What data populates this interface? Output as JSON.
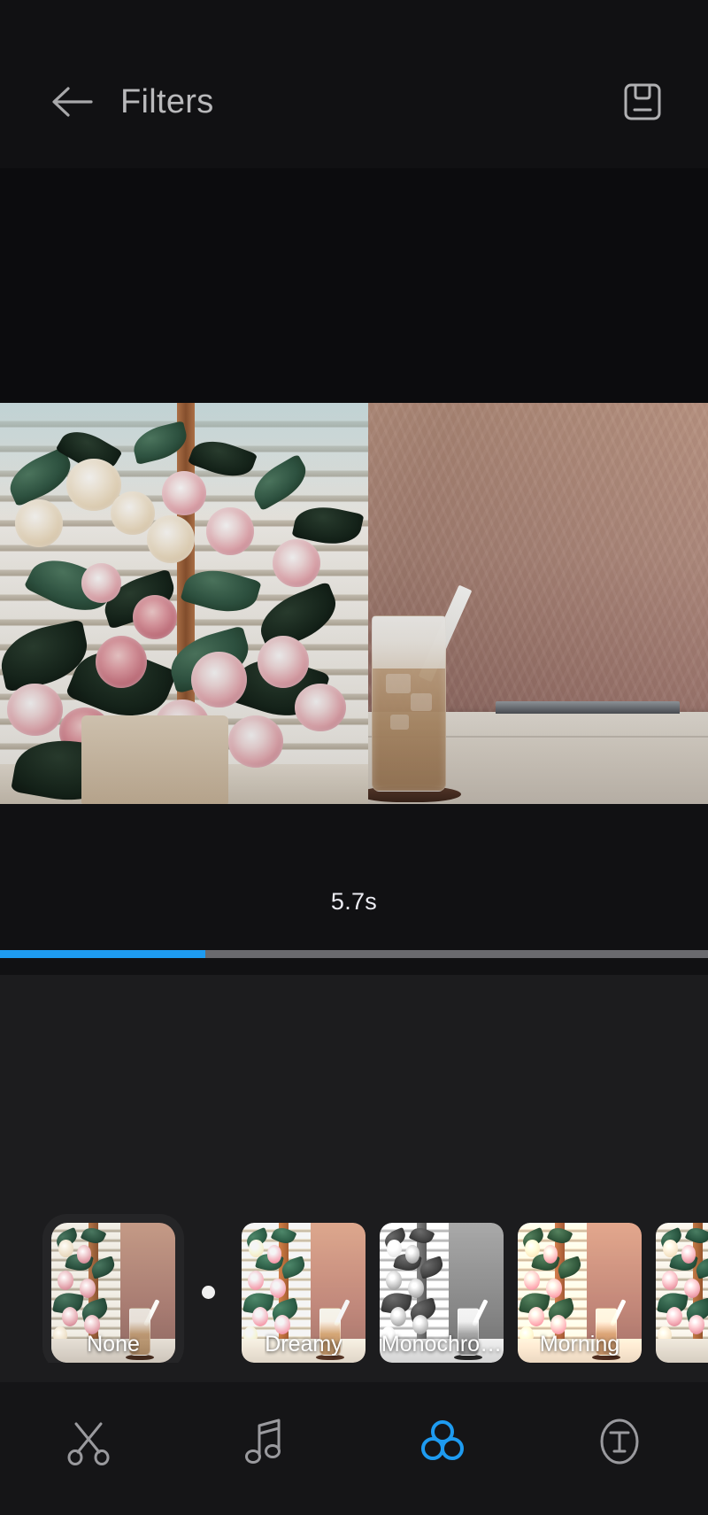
{
  "header": {
    "back_icon": "arrow-left-icon",
    "title": "Filters",
    "save_icon": "save-floppy-icon"
  },
  "preview": {
    "description": "Video preview frame: bouquet of pink and cream roses beside a window with blinds, iced latte in a tall glass on a white table"
  },
  "timeline": {
    "duration": "5.7s",
    "progress_percent": 29,
    "fill_color": "#1e9bf0",
    "track_color": "#6a6a6e"
  },
  "filters": {
    "selected_index": 0,
    "items": [
      {
        "label": "None",
        "fx": "fx-none"
      },
      {
        "label": "Dreamy",
        "fx": "fx-dreamy"
      },
      {
        "label": "Monochro…",
        "fx": "fx-mono"
      },
      {
        "label": "Morning",
        "fx": "fx-morning"
      },
      {
        "label": "",
        "fx": "fx-extra"
      }
    ]
  },
  "bottom_nav": {
    "active_index": 2,
    "active_color": "#1e9bf0",
    "inactive_color": "#9a9a9e",
    "items": [
      {
        "icon": "scissors-icon",
        "name": "trim"
      },
      {
        "icon": "music-note-icon",
        "name": "audio"
      },
      {
        "icon": "filter-circles-icon",
        "name": "filters"
      },
      {
        "icon": "text-t-icon",
        "name": "text"
      }
    ]
  },
  "colors": {
    "background_top": "#111113",
    "background_filters": "#1c1c1e",
    "background_nav": "#151517",
    "accent": "#1e9bf0",
    "title_text": "#b9b9bb"
  }
}
